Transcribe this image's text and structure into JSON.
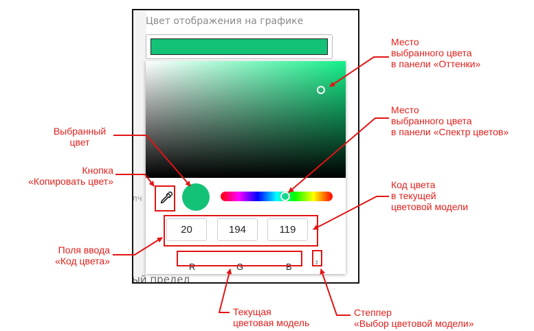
{
  "background": {
    "label": "Цвет отображения на графике",
    "bottom_fragment": "ый предел",
    "small_fragment": "лч"
  },
  "picker": {
    "selected_color": "#14c277",
    "rgb": {
      "r": "20",
      "g": "194",
      "b": "119"
    },
    "model_labels": {
      "r": "R",
      "g": "G",
      "b": "B"
    },
    "stepper_symbol": "⇕"
  },
  "annotations": {
    "sv_place": [
      "Место",
      "выбранного цвета",
      "в панели «Оттенки»"
    ],
    "hue_place": [
      "Место",
      "выбранного цвета",
      "в панели «Спектр цветов»"
    ],
    "selected_color": [
      "Выбранный",
      "цвет"
    ],
    "copy_button": [
      "Кнопка",
      "«Копировать цвет»"
    ],
    "color_code": [
      "Код цвета",
      "в текущей",
      "цветовой модели"
    ],
    "input_fields": [
      "Поля ввода",
      "«Код цвета»"
    ],
    "current_model": [
      "Текущая",
      "цветовая модель"
    ],
    "stepper": [
      "Степпер",
      "«Выбор цветовой модели»"
    ]
  },
  "colors": {
    "accent_red": "#e21414",
    "selected_green": "#14c277"
  }
}
